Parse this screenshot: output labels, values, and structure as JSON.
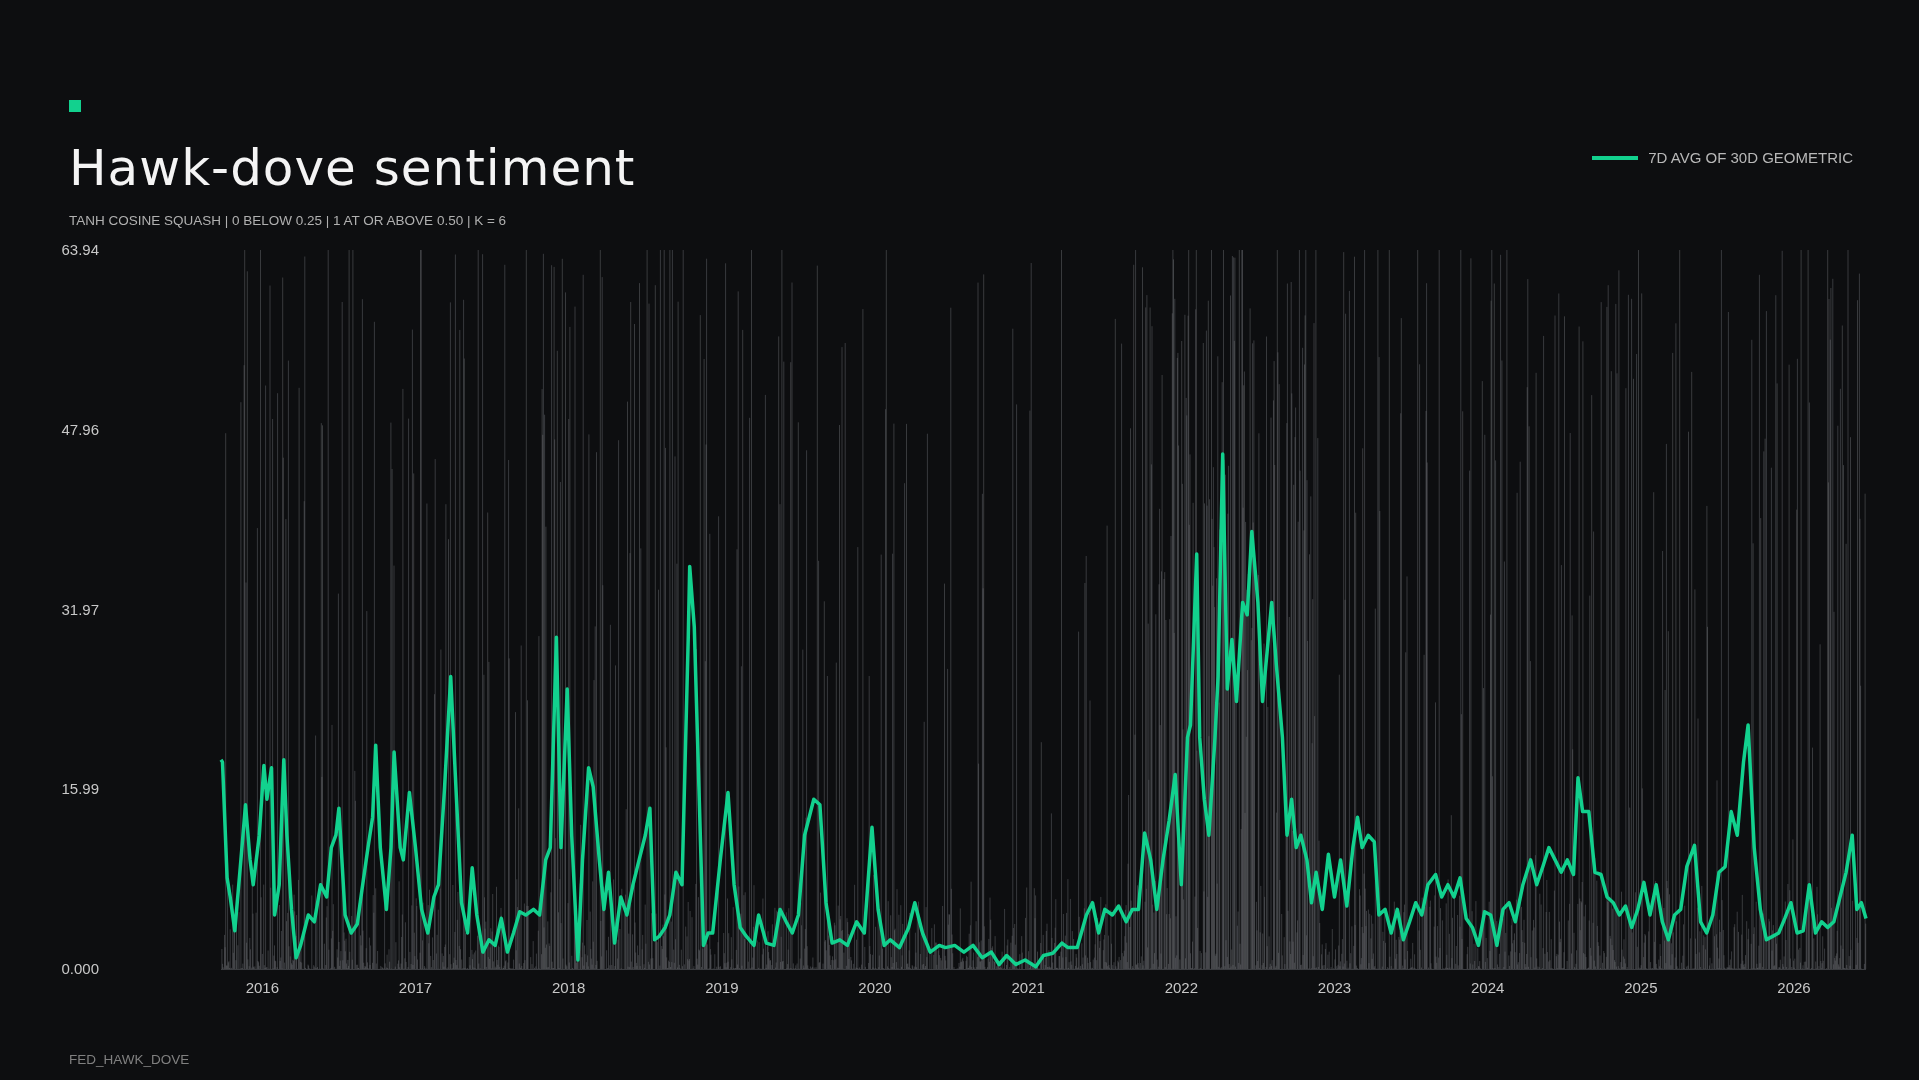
{
  "title": "Hawk-dove sentiment",
  "subtitle": "TANH COSINE SQUASH | 0 BELOW 0.25 | 1 AT OR ABOVE 0.50 | K = 6",
  "chart_data": {
    "type": "line",
    "xlim": [
      2015.73,
      2026.47
    ],
    "ylim": [
      0,
      63.94
    ],
    "xticks": [
      2016,
      2017,
      2018,
      2019,
      2020,
      2021,
      2022,
      2023,
      2024,
      2025,
      2026
    ],
    "yticks": [
      {
        "value": 0,
        "label": "0.000"
      },
      {
        "value": 15.99,
        "label": "15.99"
      },
      {
        "value": 31.97,
        "label": "31.97"
      },
      {
        "value": 47.96,
        "label": "47.96"
      },
      {
        "value": 63.94,
        "label": "63.94"
      }
    ],
    "x": [
      2015.73,
      2015.74,
      2015.77,
      2015.79,
      2015.82,
      2015.86,
      2015.89,
      2015.92,
      2015.94,
      2015.98,
      2016.01,
      2016.03,
      2016.06,
      2016.08,
      2016.11,
      2016.14,
      2016.16,
      2016.19,
      2016.22,
      2016.25,
      2016.3,
      2016.34,
      2016.38,
      2016.42,
      2016.45,
      2016.48,
      2016.5,
      2016.54,
      2016.58,
      2016.62,
      2016.65,
      2016.69,
      2016.72,
      2016.74,
      2016.77,
      2016.81,
      2016.84,
      2016.86,
      2016.9,
      2016.92,
      2016.96,
      2017.0,
      2017.04,
      2017.08,
      2017.12,
      2017.15,
      2017.19,
      2017.23,
      2017.26,
      2017.3,
      2017.34,
      2017.37,
      2017.4,
      2017.44,
      2017.48,
      2017.52,
      2017.56,
      2017.6,
      2017.64,
      2017.68,
      2017.72,
      2017.77,
      2017.81,
      2017.85,
      2017.88,
      2017.92,
      2017.95,
      2017.99,
      2018.02,
      2018.06,
      2018.09,
      2018.13,
      2018.16,
      2018.2,
      2018.23,
      2018.26,
      2018.3,
      2018.34,
      2018.38,
      2018.42,
      2018.46,
      2018.5,
      2018.53,
      2018.56,
      2018.59,
      2018.63,
      2018.66,
      2018.7,
      2018.74,
      2018.78,
      2018.79,
      2018.82,
      2018.85,
      2018.88,
      2018.91,
      2018.94,
      2018.99,
      2019.04,
      2019.08,
      2019.12,
      2019.16,
      2019.21,
      2019.24,
      2019.29,
      2019.34,
      2019.38,
      2019.42,
      2019.46,
      2019.5,
      2019.54,
      2019.6,
      2019.64,
      2019.68,
      2019.72,
      2019.77,
      2019.82,
      2019.88,
      2019.93,
      2019.98,
      2020.02,
      2020.06,
      2020.1,
      2020.16,
      2020.22,
      2020.26,
      2020.31,
      2020.36,
      2020.42,
      2020.46,
      2020.52,
      2020.58,
      2020.64,
      2020.7,
      2020.76,
      2020.81,
      2020.86,
      2020.92,
      2020.98,
      2021.05,
      2021.1,
      2021.16,
      2021.22,
      2021.26,
      2021.32,
      2021.38,
      2021.42,
      2021.46,
      2021.5,
      2021.55,
      2021.59,
      2021.64,
      2021.68,
      2021.72,
      2021.76,
      2021.8,
      2021.84,
      2021.88,
      2021.92,
      2021.96,
      2022.0,
      2022.04,
      2022.06,
      2022.1,
      2022.12,
      2022.15,
      2022.18,
      2022.22,
      2022.24,
      2022.27,
      2022.3,
      2022.33,
      2022.36,
      2022.4,
      2022.43,
      2022.46,
      2022.5,
      2022.53,
      2022.56,
      2022.59,
      2022.62,
      2022.66,
      2022.69,
      2022.72,
      2022.75,
      2022.78,
      2022.82,
      2022.85,
      2022.88,
      2022.92,
      2022.96,
      2023.0,
      2023.04,
      2023.08,
      2023.12,
      2023.15,
      2023.18,
      2023.22,
      2023.26,
      2023.29,
      2023.33,
      2023.37,
      2023.41,
      2023.45,
      2023.49,
      2023.53,
      2023.57,
      2023.61,
      2023.66,
      2023.7,
      2023.74,
      2023.78,
      2023.82,
      2023.86,
      2023.9,
      2023.94,
      2023.98,
      2024.02,
      2024.06,
      2024.1,
      2024.14,
      2024.18,
      2024.23,
      2024.28,
      2024.32,
      2024.36,
      2024.4,
      2024.44,
      2024.48,
      2024.52,
      2024.56,
      2024.59,
      2024.62,
      2024.66,
      2024.7,
      2024.74,
      2024.78,
      2024.82,
      2024.86,
      2024.9,
      2024.94,
      2024.98,
      2025.02,
      2025.06,
      2025.1,
      2025.14,
      2025.18,
      2025.22,
      2025.26,
      2025.3,
      2025.35,
      2025.39,
      2025.43,
      2025.47,
      2025.51,
      2025.55,
      2025.59,
      2025.63,
      2025.67,
      2025.7,
      2025.74,
      2025.78,
      2025.82,
      2025.86,
      2025.9,
      2025.94,
      2025.98,
      2026.02,
      2026.06,
      2026.1,
      2026.14,
      2026.18,
      2026.22,
      2026.26,
      2026.3,
      2026.34,
      2026.38,
      2026.41,
      2026.44,
      2026.47
    ],
    "series": [
      {
        "name": "7D AVG OF 30D GEOMETRIC",
        "color": "#12d18e",
        "values": [
          18.6,
          18.4,
          8.1,
          6.4,
          3.4,
          9.7,
          14.6,
          9.7,
          7.5,
          11.9,
          18.1,
          15.1,
          17.9,
          4.8,
          7.5,
          18.6,
          11.9,
          5.3,
          1.0,
          2.1,
          4.8,
          4.2,
          7.5,
          6.4,
          10.8,
          11.9,
          14.3,
          4.8,
          3.2,
          4.0,
          7.0,
          10.8,
          13.5,
          19.9,
          10.8,
          5.3,
          10.8,
          19.3,
          10.8,
          9.7,
          15.7,
          10.8,
          5.3,
          3.2,
          6.4,
          7.5,
          16.2,
          26.0,
          17.3,
          5.9,
          3.2,
          9.0,
          4.8,
          1.5,
          2.6,
          2.1,
          4.5,
          1.5,
          3.2,
          5.1,
          4.8,
          5.3,
          4.8,
          9.7,
          10.8,
          29.5,
          10.8,
          24.9,
          11.9,
          0.8,
          9.7,
          17.9,
          16.2,
          9.7,
          5.3,
          8.6,
          2.3,
          6.4,
          4.8,
          7.5,
          9.7,
          11.9,
          14.3,
          2.6,
          2.9,
          3.7,
          4.8,
          8.6,
          7.5,
          29.3,
          35.8,
          30.4,
          16.2,
          2.1,
          3.2,
          3.2,
          9.7,
          15.7,
          7.5,
          3.7,
          2.9,
          2.1,
          4.8,
          2.3,
          2.1,
          5.3,
          4.2,
          3.2,
          4.8,
          11.9,
          15.1,
          14.6,
          5.9,
          2.3,
          2.6,
          2.1,
          4.2,
          3.2,
          12.6,
          5.3,
          2.1,
          2.6,
          1.9,
          3.7,
          5.9,
          3.2,
          1.5,
          2.1,
          1.9,
          2.1,
          1.5,
          2.1,
          1.0,
          1.5,
          0.4,
          1.2,
          0.4,
          0.8,
          0.2,
          1.2,
          1.4,
          2.3,
          1.9,
          1.9,
          4.8,
          5.9,
          3.2,
          5.3,
          4.8,
          5.6,
          4.2,
          5.3,
          5.3,
          12.1,
          9.7,
          5.3,
          9.7,
          13.2,
          17.3,
          7.5,
          20.6,
          21.7,
          36.9,
          20.6,
          15.1,
          11.9,
          20.6,
          26.0,
          45.8,
          24.9,
          29.3,
          23.8,
          32.6,
          31.5,
          38.9,
          32.6,
          23.8,
          28.2,
          32.6,
          27.1,
          20.6,
          11.9,
          15.1,
          10.8,
          11.9,
          9.7,
          5.9,
          8.6,
          5.3,
          10.2,
          6.4,
          9.7,
          5.6,
          10.8,
          13.5,
          10.8,
          11.9,
          11.3,
          4.8,
          5.3,
          3.2,
          5.3,
          2.6,
          4.2,
          5.9,
          4.8,
          7.5,
          8.4,
          6.4,
          7.5,
          6.4,
          8.1,
          4.5,
          3.7,
          2.1,
          5.1,
          4.8,
          2.1,
          5.3,
          5.9,
          4.2,
          7.5,
          9.7,
          7.5,
          9.1,
          10.8,
          9.7,
          8.6,
          9.7,
          8.4,
          17.0,
          14.0,
          14.0,
          8.6,
          8.4,
          6.4,
          5.9,
          4.8,
          5.6,
          3.7,
          5.3,
          7.7,
          4.8,
          7.5,
          4.2,
          2.6,
          4.8,
          5.3,
          9.1,
          11.0,
          4.2,
          3.2,
          4.8,
          8.6,
          9.1,
          14.0,
          11.9,
          18.4,
          21.7,
          10.8,
          5.3,
          2.6,
          2.9,
          3.2,
          4.5,
          5.9,
          3.2,
          3.4,
          7.5,
          3.2,
          4.2,
          3.7,
          4.2,
          6.4,
          8.6,
          11.9,
          5.3,
          5.9,
          4.5
        ]
      }
    ]
  },
  "footer": "FED_HAWK_DOVE"
}
